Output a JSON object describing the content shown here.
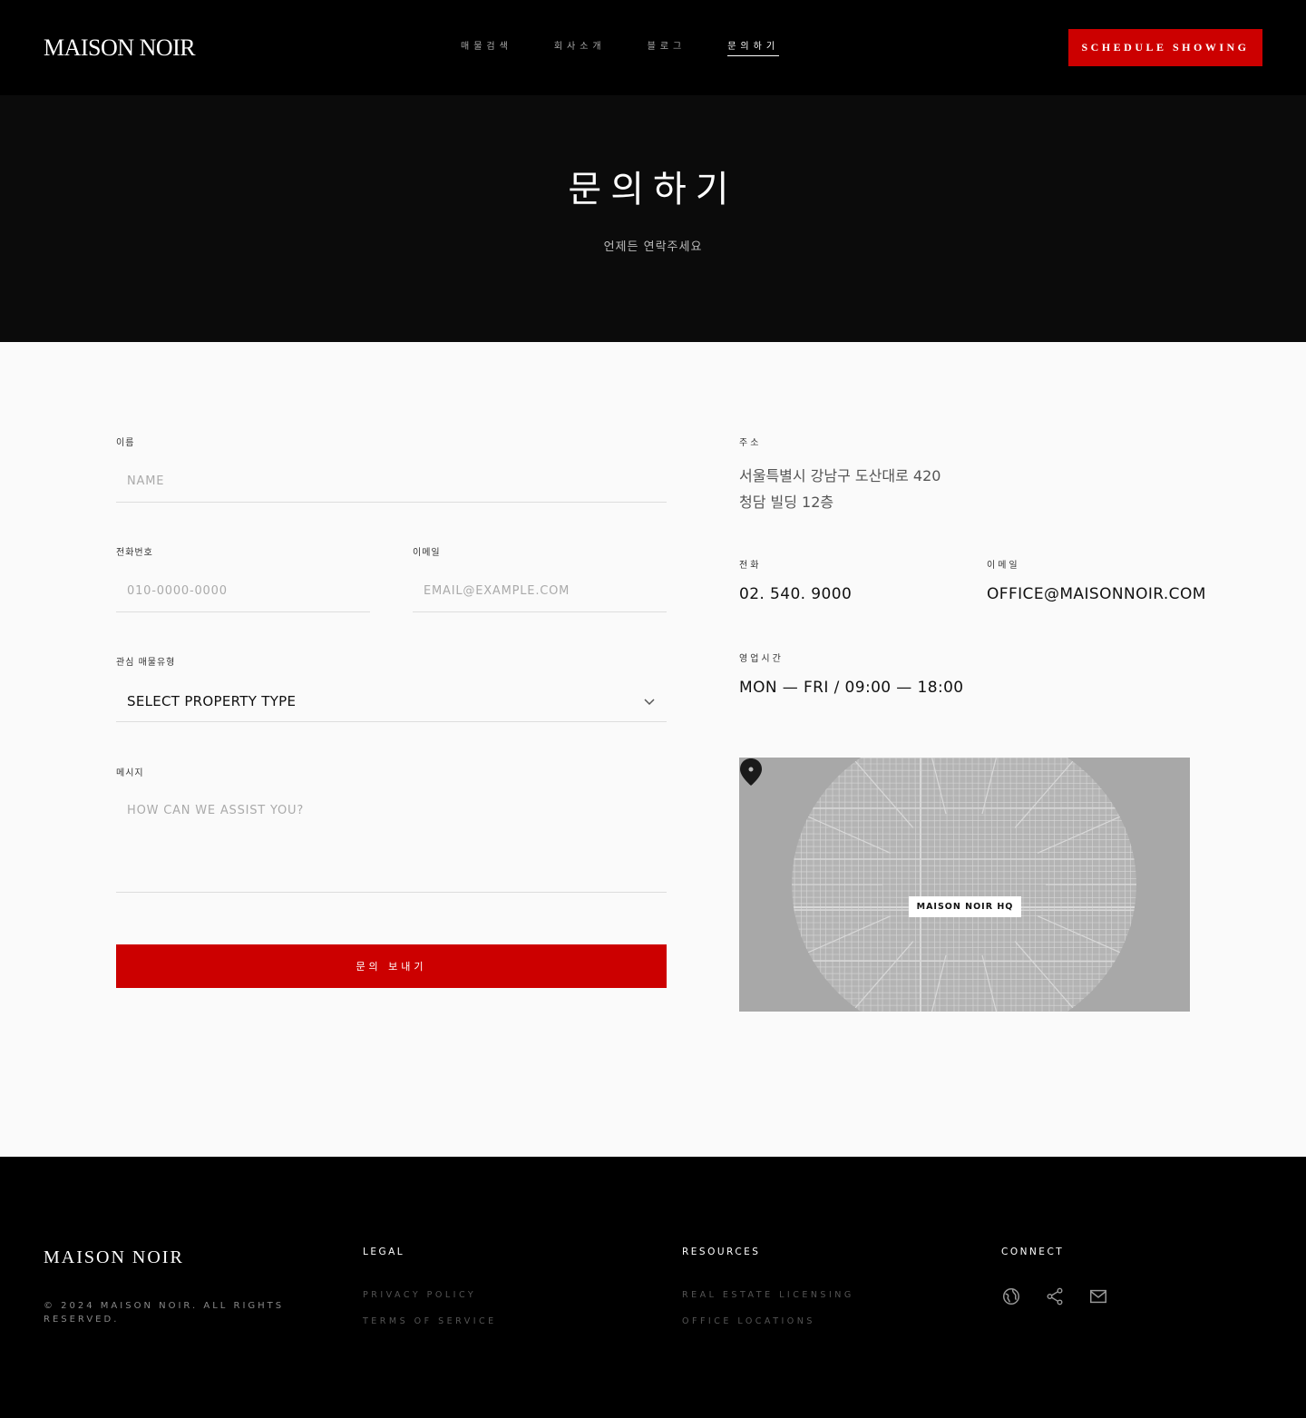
{
  "header": {
    "logo": "MAISON NOIR",
    "nav": [
      {
        "label": "매물검색",
        "active": false
      },
      {
        "label": "회사소개",
        "active": false
      },
      {
        "label": "블로그",
        "active": false
      },
      {
        "label": "문의하기",
        "active": true
      }
    ],
    "cta_label": "SCHEDULE SHOWING"
  },
  "hero": {
    "title": "문의하기",
    "subtitle": "언제든 연락주세요"
  },
  "form": {
    "name": {
      "label": "이름",
      "placeholder": "NAME",
      "value": ""
    },
    "phone": {
      "label": "전화번호",
      "placeholder": "010-0000-0000",
      "value": ""
    },
    "email": {
      "label": "이메일",
      "placeholder": "EMAIL@EXAMPLE.COM",
      "value": ""
    },
    "property": {
      "label": "관심 매물유형",
      "selected": "SELECT PROPERTY TYPE"
    },
    "message": {
      "label": "메시지",
      "placeholder": "HOW CAN WE ASSIST YOU?",
      "value": ""
    },
    "submit_label": "문의 보내기"
  },
  "info": {
    "address_label": "주소",
    "address_line1": "서울특별시 강남구 도산대로 420",
    "address_line2": "청담 빌딩 12층",
    "phone_label": "전화",
    "phone_value": "02. 540. 9000",
    "email_label": "이메일",
    "email_value": "OFFICE@MAISONNOIR.COM",
    "hours_label": "영업시간",
    "hours_value": "MON — FRI / 09:00 — 18:00"
  },
  "map": {
    "marker_label": "MAISON NOIR HQ",
    "icon": "map-pin-icon"
  },
  "footer": {
    "logo": "MAISON NOIR",
    "copyright": "© 2024 MAISON NOIR. ALL RIGHTS RESERVED.",
    "legal": {
      "heading": "LEGAL",
      "links": [
        "PRIVACY POLICY",
        "TERMS OF SERVICE"
      ]
    },
    "resources": {
      "heading": "RESOURCES",
      "links": [
        "REAL ESTATE LICENSING",
        "OFFICE LOCATIONS"
      ]
    },
    "connect": {
      "heading": "CONNECT",
      "icons": [
        "globe-icon",
        "share-icon",
        "mail-icon"
      ]
    }
  },
  "colors": {
    "accent": "#cc0000",
    "header_bg": "#000000",
    "hero_bg": "#0b0b0b",
    "page_bg": "#fafafa",
    "map_bg": "#a8a8a8"
  }
}
